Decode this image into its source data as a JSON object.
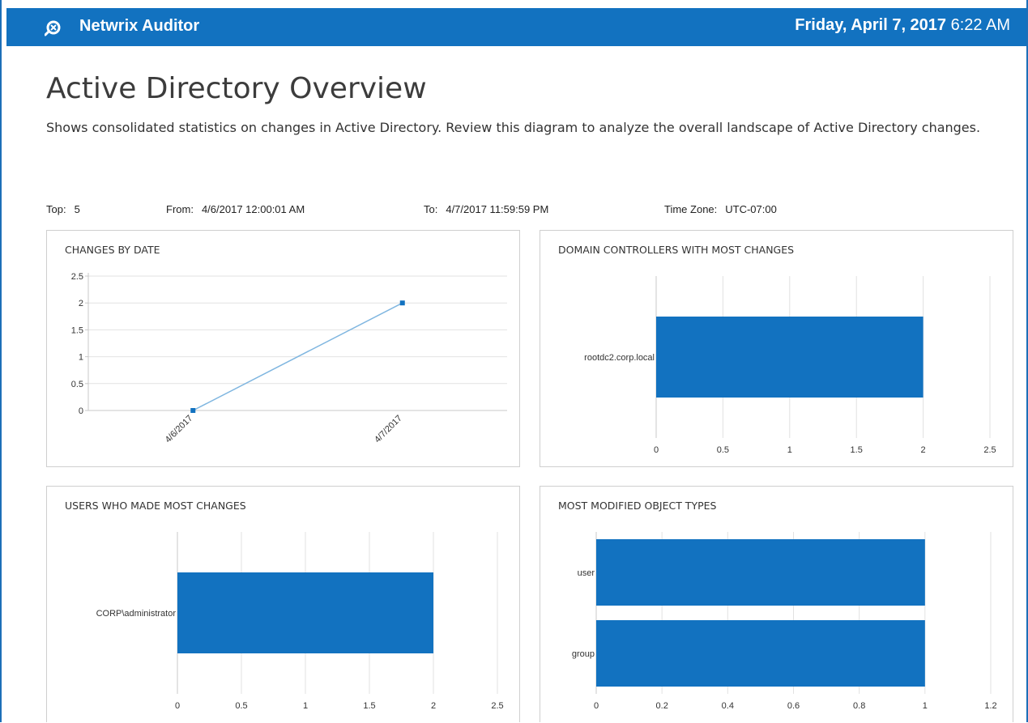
{
  "header": {
    "app_name": "Netwrix Auditor",
    "date": "Friday, April 7, 2017",
    "time": "6:22 AM",
    "color": "#1272c0"
  },
  "report": {
    "title": "Active Directory Overview",
    "description": "Shows consolidated statistics on changes in Active Directory. Review this diagram to analyze the overall landscape of Active Directory changes."
  },
  "params": {
    "top_label": "Top:",
    "top_value": "5",
    "from_label": "From:",
    "from_value": "4/6/2017 12:00:01 AM",
    "to_label": "To:",
    "to_value": "4/7/2017 11:59:59 PM",
    "tz_label": "Time Zone:",
    "tz_value": "UTC-07:00"
  },
  "chart_data": [
    {
      "id": "changes_by_date",
      "type": "line",
      "title": "CHANGES BY DATE",
      "categories": [
        "4/6/2017",
        "4/7/2017"
      ],
      "values": [
        0,
        2
      ],
      "yticks": [
        "0",
        "0.5",
        "1",
        "1.5",
        "2",
        "2.5"
      ],
      "ylim": [
        0,
        2.5
      ],
      "grid": true,
      "color": "#7fb6e0"
    },
    {
      "id": "dc_most_changes",
      "type": "bar",
      "orientation": "horizontal",
      "title": "DOMAIN CONTROLLERS WITH MOST CHANGES",
      "categories": [
        "rootdc2.corp.local"
      ],
      "values": [
        2
      ],
      "xticks": [
        "0",
        "0.5",
        "1",
        "1.5",
        "2",
        "2.5"
      ],
      "xlim": [
        0,
        2.5
      ],
      "grid": true,
      "color": "#1272c0"
    },
    {
      "id": "users_most_changes",
      "type": "bar",
      "orientation": "horizontal",
      "title": "USERS WHO MADE MOST CHANGES",
      "categories": [
        "CORP\\administrator"
      ],
      "values": [
        2
      ],
      "xticks": [
        "0",
        "0.5",
        "1",
        "1.5",
        "2",
        "2.5"
      ],
      "xlim": [
        0,
        2.5
      ],
      "grid": true,
      "color": "#1272c0"
    },
    {
      "id": "object_types",
      "type": "bar",
      "orientation": "horizontal",
      "title": "MOST MODIFIED OBJECT TYPES",
      "categories": [
        "user",
        "group"
      ],
      "values": [
        1,
        1
      ],
      "xticks": [
        "0",
        "0.2",
        "0.4",
        "0.6",
        "0.8",
        "1",
        "1.2"
      ],
      "xlim": [
        0,
        1.2
      ],
      "grid": true,
      "color": "#1272c0"
    }
  ]
}
